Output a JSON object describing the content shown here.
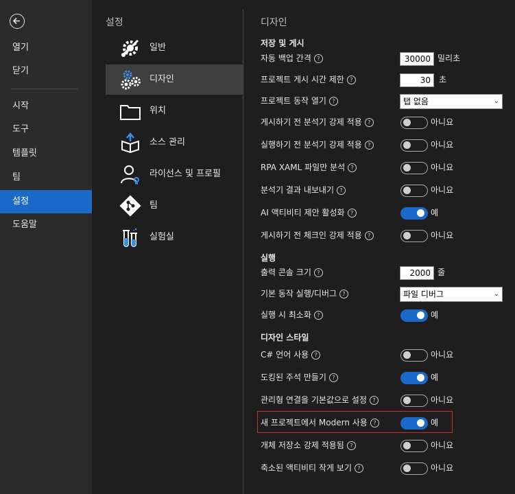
{
  "leftnav": {
    "items": [
      {
        "label": "열기"
      },
      {
        "label": "닫기"
      },
      {
        "label": "시작"
      },
      {
        "label": "도구"
      },
      {
        "label": "템플릿"
      },
      {
        "label": "팀"
      },
      {
        "label": "설정",
        "active": true
      },
      {
        "label": "도움말"
      }
    ]
  },
  "midcol": {
    "header": "설정",
    "items": [
      {
        "label": "일반",
        "icon": "wrench-gear-icon"
      },
      {
        "label": "디자인",
        "icon": "gears-icon",
        "active": true
      },
      {
        "label": "위치",
        "icon": "folder-icon"
      },
      {
        "label": "소스 관리",
        "icon": "source-box-icon"
      },
      {
        "label": "라이선스 및 프로필",
        "icon": "user-license-icon"
      },
      {
        "label": "팀",
        "icon": "git-icon"
      },
      {
        "label": "실험실",
        "icon": "flask-icon"
      }
    ]
  },
  "content": {
    "header": "디자인",
    "sections": {
      "save_publish": "저장 및 게시",
      "run": "실행",
      "design_style": "디자인 스타일"
    },
    "rows": {
      "autosave": {
        "label": "자동 백업 간격",
        "value": "30000",
        "unit": "밀리초"
      },
      "publish_timeout": {
        "label": "프로젝트 게시 시간 제한",
        "value": "30",
        "unit": "초"
      },
      "project_open": {
        "label": "프로젝트 동작 열기",
        "value": "탭 없음"
      },
      "analyzer_publish": {
        "label": "게시하기 전 분석기 강제 적용",
        "state": "아니요"
      },
      "analyzer_run": {
        "label": "실행하기 전 분석기 강제 적용",
        "state": "아니요"
      },
      "rpa_xaml": {
        "label": "RPA XAML 파일만 분석",
        "state": "아니요"
      },
      "export_analyzer": {
        "label": "분석기 결과 내보내기",
        "state": "아니요"
      },
      "ai_activity": {
        "label": "AI 액티비티 제안 활성화",
        "state": "예"
      },
      "checkin_publish": {
        "label": "게시하기 전 체크인 강제 적용",
        "state": "아니요"
      },
      "console_size": {
        "label": "출력 콘솔 크기",
        "value": "2000",
        "unit": "줄"
      },
      "default_run": {
        "label": "기본 동작 실행/디버그",
        "value": "파일 디버그"
      },
      "minimize_run": {
        "label": "실행 시 최소화",
        "state": "예"
      },
      "csharp": {
        "label": "C# 언어 사용",
        "state": "아니요"
      },
      "docked_annotations": {
        "label": "도킹된 주석 만들기",
        "state": "예"
      },
      "managed_connections": {
        "label": "관리형 연결을 기본값으로 설정",
        "state": "아니요"
      },
      "modern_new": {
        "label": "새 프로젝트에서 Modern 사용",
        "state": "예"
      },
      "object_repo": {
        "label": "개체 저장소 강제 적용됨",
        "state": "아니요"
      },
      "collapsed_small": {
        "label": "축소된 액티비티 작게 보기",
        "state": "아니요"
      }
    }
  },
  "colors": {
    "accent": "#1b6ac9",
    "highlight_border": "#c9302c"
  }
}
